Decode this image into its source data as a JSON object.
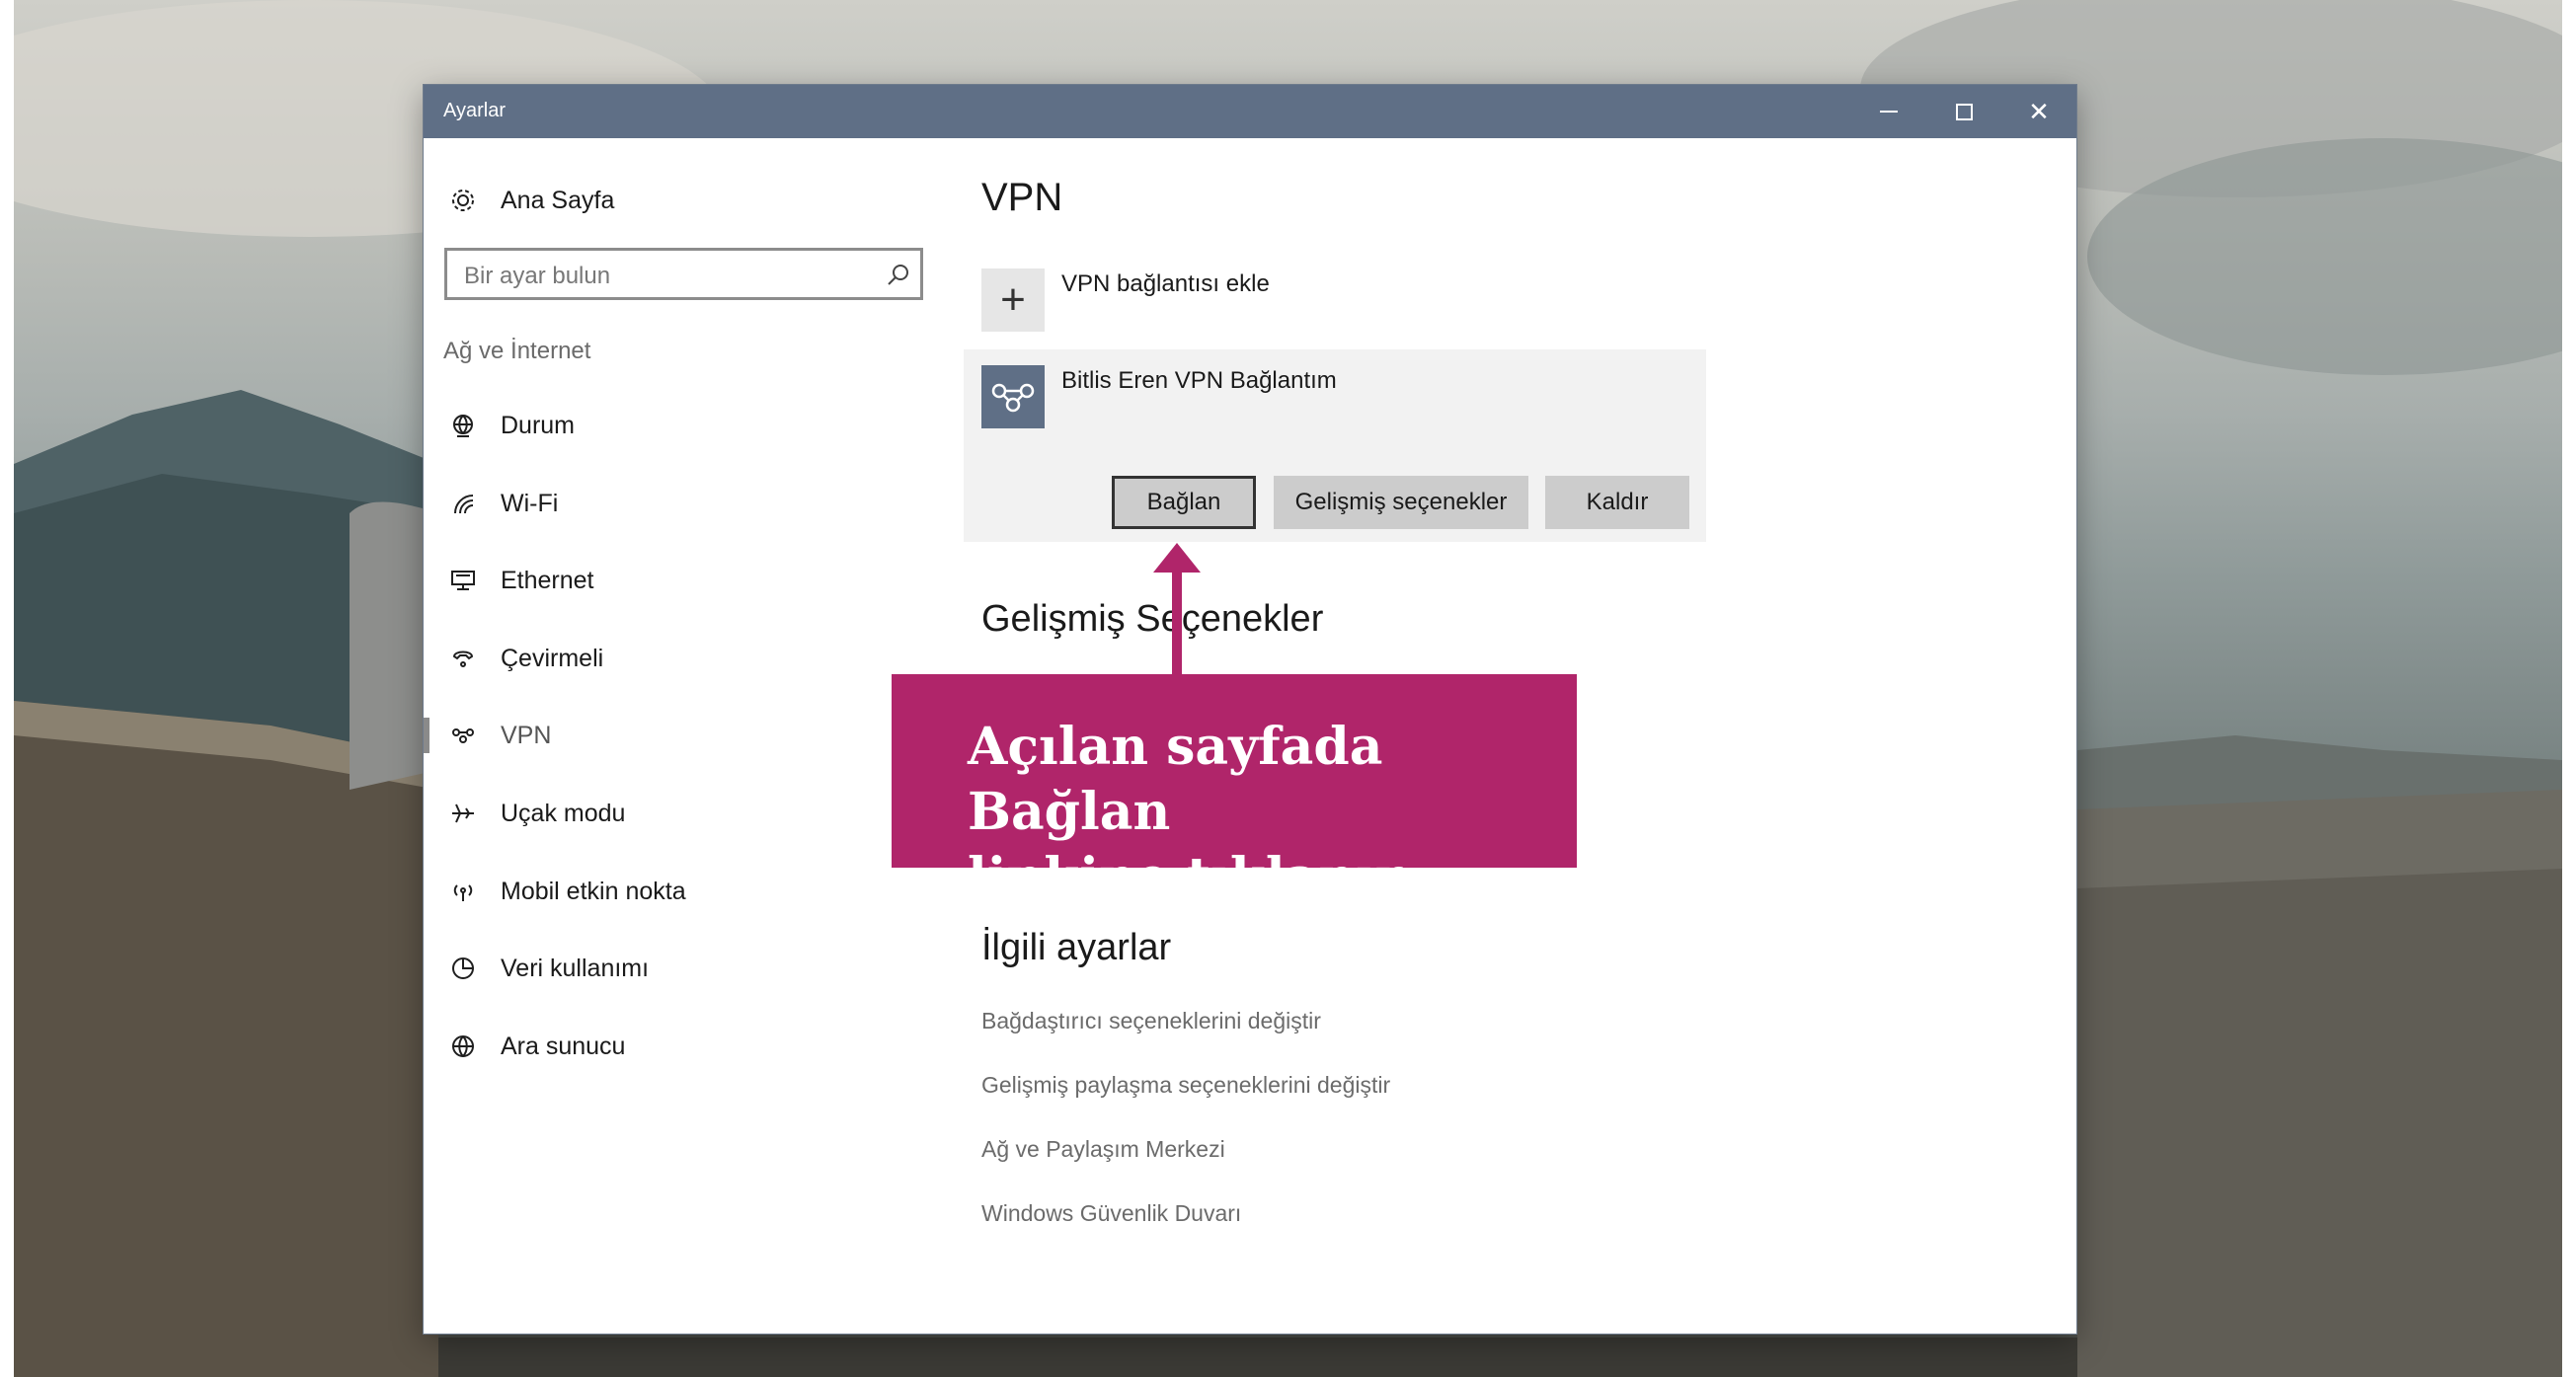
{
  "window": {
    "title": "Ayarlar",
    "titlebar_color": "#5f6f86"
  },
  "sidebar": {
    "home_label": "Ana Sayfa",
    "search_placeholder": "Bir ayar bulun",
    "section_label": "Ağ ve İnternet",
    "items": [
      {
        "label": "Durum",
        "icon": "globe-status-icon"
      },
      {
        "label": "Wi-Fi",
        "icon": "wifi-icon"
      },
      {
        "label": "Ethernet",
        "icon": "ethernet-icon"
      },
      {
        "label": "Çevirmeli",
        "icon": "dialup-icon"
      },
      {
        "label": "VPN",
        "icon": "vpn-icon",
        "active": true
      },
      {
        "label": "Uçak modu",
        "icon": "airplane-icon"
      },
      {
        "label": "Mobil etkin nokta",
        "icon": "hotspot-icon"
      },
      {
        "label": "Veri kullanımı",
        "icon": "data-usage-icon"
      },
      {
        "label": "Ara sunucu",
        "icon": "proxy-globe-icon"
      }
    ]
  },
  "main": {
    "heading": "VPN",
    "add_vpn_label": "VPN bağlantısı ekle",
    "connection": {
      "name": "Bitlis Eren VPN Bağlantım",
      "buttons": {
        "connect": "Bağlan",
        "advanced": "Gelişmiş seçenekler",
        "remove": "Kaldır"
      }
    },
    "advanced_heading": "Gelişmiş Seçenekler",
    "related_heading": "İlgili ayarlar",
    "related_links": [
      "Bağdaştırıcı seçeneklerini değiştir",
      "Gelişmiş paylaşma seçeneklerini değiştir",
      "Ağ ve Paylaşım Merkezi",
      "Windows Güvenlik Duvarı"
    ]
  },
  "annotation": {
    "line1": "Açılan sayfada Bağlan",
    "line2": "linkine tıklanır.",
    "color": "#b0256a"
  }
}
